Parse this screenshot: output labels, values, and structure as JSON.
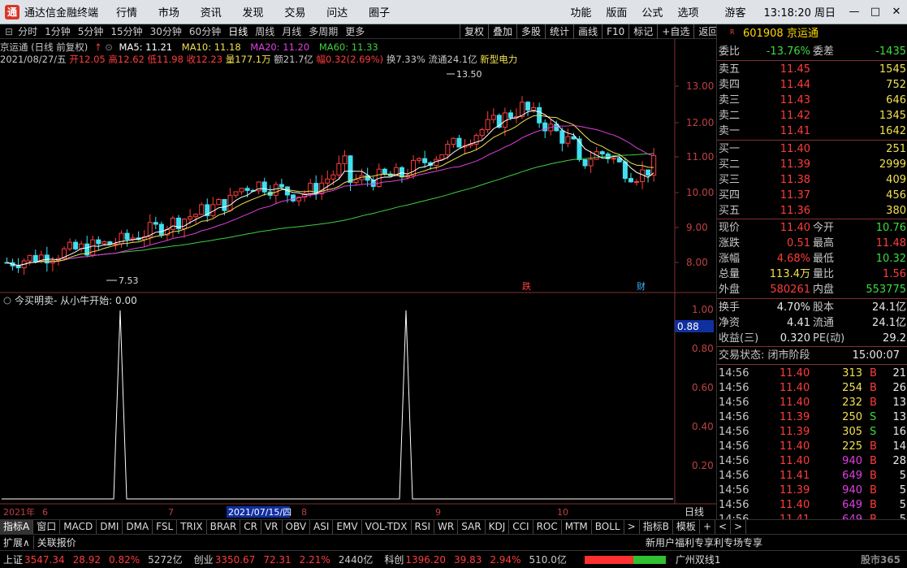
{
  "app": {
    "logo": "通",
    "name": "通达信金融终端"
  },
  "menu": [
    "行情",
    "市场",
    "资讯",
    "发现",
    "交易",
    "问达",
    "圈子"
  ],
  "topright": {
    "funcs": [
      "功能",
      "版面",
      "公式",
      "选项"
    ],
    "guest": "游客",
    "clock": "13:18:20 周日",
    "win_min": "—",
    "win_max": "□",
    "win_close": "✕"
  },
  "periods": [
    "分时",
    "1分钟",
    "5分钟",
    "15分钟",
    "30分钟",
    "60分钟",
    "日线",
    "周线",
    "月线",
    "多周期",
    "更多"
  ],
  "active_period": "日线",
  "toolbar": [
    "复权",
    "叠加",
    "多股",
    "统计",
    "画线",
    "F10",
    "标记",
    "+自选",
    "返回"
  ],
  "chart": {
    "header": "京运通 (日线 前复权)",
    "ma5": "MA5: 11.21",
    "ma10": "MA10: 11.18",
    "ma20": "MA20: 11.20",
    "ma60": "MA60: 11.33",
    "info_date": "2021/08/27/五",
    "info_open": "开12.05",
    "info_high": "高12.62",
    "info_low": "低11.98",
    "info_close": "收12.23",
    "info_vol": "量177.1万",
    "info_amt": "额21.7亿",
    "info_chg": "幅0.32(2.69%)",
    "info_turn": "换7.33%",
    "info_float": "流通24.1亿",
    "info_concept": "新型电力",
    "max_label": "13.50",
    "min_label": "7.53",
    "price_ticks": [
      "13.00",
      "12.00",
      "11.00",
      "10.00",
      "9.00",
      "8.00"
    ],
    "marker_fall": "跌",
    "marker_fin": "财",
    "indicator_title": "今买明卖- 从小牛开始: 0.00",
    "ind_ticks": [
      "1.00",
      "0.80",
      "0.60",
      "0.40",
      "0.20"
    ],
    "ind_cursor": "0.88",
    "dates": [
      "2021年",
      "6",
      "7",
      "2021/07/15/四",
      "8",
      "9",
      "10"
    ],
    "period_label": "日线"
  },
  "colors": {
    "up": "#ff3c3c",
    "down": "#40e0f0",
    "ma5": "#ffffff",
    "ma10": "#f0e050",
    "ma20": "#e040e0",
    "ma60": "#40d040"
  },
  "stock": {
    "code": "601908",
    "name": "京运通"
  },
  "orderbook": {
    "weibi_label": "委比",
    "weibi": "-13.76%",
    "weicha_label": "委差",
    "weicha": "-1435",
    "asks": [
      {
        "label": "卖五",
        "price": "11.45",
        "vol": "1545"
      },
      {
        "label": "卖四",
        "price": "11.44",
        "vol": "752"
      },
      {
        "label": "卖三",
        "price": "11.43",
        "vol": "646"
      },
      {
        "label": "卖二",
        "price": "11.42",
        "vol": "1345"
      },
      {
        "label": "卖一",
        "price": "11.41",
        "vol": "1642"
      }
    ],
    "bids": [
      {
        "label": "买一",
        "price": "11.40",
        "vol": "251"
      },
      {
        "label": "买二",
        "price": "11.39",
        "vol": "2999"
      },
      {
        "label": "买三",
        "price": "11.38",
        "vol": "409"
      },
      {
        "label": "买四",
        "price": "11.37",
        "vol": "456"
      },
      {
        "label": "买五",
        "price": "11.36",
        "vol": "380"
      }
    ]
  },
  "quote": [
    {
      "l1": "现价",
      "v1": "11.40",
      "c1": "red",
      "l2": "今开",
      "v2": "10.76",
      "c2": "green"
    },
    {
      "l1": "涨跌",
      "v1": "0.51",
      "c1": "red",
      "l2": "最高",
      "v2": "11.48",
      "c2": "red"
    },
    {
      "l1": "涨幅",
      "v1": "4.68%",
      "c1": "red",
      "l2": "最低",
      "v2": "10.32",
      "c2": "green"
    },
    {
      "l1": "总量",
      "v1": "113.4万",
      "c1": "yellow",
      "l2": "量比",
      "v2": "1.56",
      "c2": "red"
    },
    {
      "l1": "外盘",
      "v1": "580261",
      "c1": "red",
      "l2": "内盘",
      "v2": "553775",
      "c2": "green"
    },
    {
      "l1": "换手",
      "v1": "4.70%",
      "c1": "white",
      "l2": "股本",
      "v2": "24.1亿",
      "c2": "white"
    },
    {
      "l1": "净资",
      "v1": "4.41",
      "c1": "white",
      "l2": "流通",
      "v2": "24.1亿",
      "c2": "white"
    },
    {
      "l1": "收益(三)",
      "v1": "0.320",
      "c1": "white",
      "l2": "PE(动)",
      "v2": "29.2",
      "c2": "white"
    }
  ],
  "trade_status": {
    "label": "交易状态: 闭市阶段",
    "time": "15:00:07"
  },
  "ticks": [
    {
      "t": "14:56",
      "p": "11.40",
      "v": "313",
      "d": "B",
      "n": "21",
      "vc": "yellow"
    },
    {
      "t": "14:56",
      "p": "11.40",
      "v": "254",
      "d": "B",
      "n": "26",
      "vc": "yellow"
    },
    {
      "t": "14:56",
      "p": "11.40",
      "v": "232",
      "d": "B",
      "n": "13",
      "vc": "yellow"
    },
    {
      "t": "14:56",
      "p": "11.39",
      "v": "250",
      "d": "S",
      "n": "13",
      "vc": "yellow"
    },
    {
      "t": "14:56",
      "p": "11.39",
      "v": "305",
      "d": "S",
      "n": "16",
      "vc": "yellow"
    },
    {
      "t": "14:56",
      "p": "11.40",
      "v": "225",
      "d": "B",
      "n": "14",
      "vc": "yellow"
    },
    {
      "t": "14:56",
      "p": "11.40",
      "v": "940",
      "d": "B",
      "n": "28",
      "vc": "mag"
    },
    {
      "t": "14:56",
      "p": "11.41",
      "v": "649",
      "d": "B",
      "n": "5",
      "vc": "mag"
    },
    {
      "t": "14:56",
      "p": "11.39",
      "v": "940",
      "d": "B",
      "n": "5",
      "vc": "mag"
    },
    {
      "t": "14:56",
      "p": "11.40",
      "v": "649",
      "d": "B",
      "n": "5",
      "vc": "mag"
    },
    {
      "t": "14:56",
      "p": "11.41",
      "v": "649",
      "d": "B",
      "n": "5",
      "vc": "mag"
    },
    {
      "t": "14:56",
      "p": "11.39",
      "v": "649",
      "d": "B",
      "n": "5",
      "vc": "mag"
    }
  ],
  "tabs": [
    "指标A",
    "窗口",
    "MACD",
    "DMI",
    "DMA",
    "FSL",
    "TRIX",
    "BRAR",
    "CR",
    "VR",
    "OBV",
    "ASI",
    "EMV",
    "VOL-TDX",
    "RSI",
    "WR",
    "SAR",
    "KDJ",
    "CCI",
    "ROC",
    "MTM",
    "BOLL",
    ">",
    "指标B",
    "模板",
    "+",
    "<",
    ">"
  ],
  "expand": {
    "btn1": "扩展∧",
    "btn2": "关联报价",
    "news": "新用户福利专享利专场专享"
  },
  "status": [
    {
      "name": "上证",
      "idx": "3547.34",
      "chg": "28.92",
      "pct": "0.82%",
      "amt": "5272亿"
    },
    {
      "name": "创业",
      "idx": "3350.67",
      "chg": "72.31",
      "pct": "2.21%",
      "amt": "2440亿"
    },
    {
      "name": "科创",
      "idx": "1396.20",
      "chg": "39.83",
      "pct": "2.94%",
      "amt": "510.0亿"
    }
  ],
  "server": "广州双线1",
  "watermark": "股市365"
}
